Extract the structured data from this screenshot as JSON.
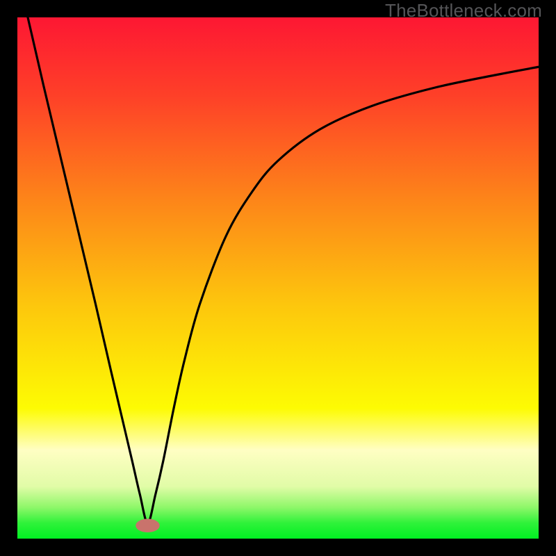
{
  "watermark": "TheBottleneck.com",
  "chart_data": {
    "type": "line",
    "title": "",
    "xlabel": "",
    "ylabel": "",
    "xlim": [
      0,
      100
    ],
    "ylim": [
      0,
      100
    ],
    "grid": false,
    "legend": false,
    "background_gradient": {
      "stops": [
        {
          "offset": 0.0,
          "color": "#fd1733"
        },
        {
          "offset": 0.15,
          "color": "#fe4028"
        },
        {
          "offset": 0.35,
          "color": "#fd8519"
        },
        {
          "offset": 0.55,
          "color": "#fdc60d"
        },
        {
          "offset": 0.75,
          "color": "#fdfb03"
        },
        {
          "offset": 0.83,
          "color": "#fffec3"
        },
        {
          "offset": 0.9,
          "color": "#e1fca7"
        },
        {
          "offset": 0.94,
          "color": "#8ef769"
        },
        {
          "offset": 0.97,
          "color": "#2ff23a"
        },
        {
          "offset": 1.0,
          "color": "#01ef22"
        }
      ]
    },
    "series": [
      {
        "name": "bottleneck-curve",
        "color": "#000000",
        "x": [
          2,
          5,
          10,
          15,
          18,
          20,
          22,
          23.5,
          25,
          26.5,
          28,
          30,
          32,
          35,
          40,
          45,
          50,
          58,
          68,
          80,
          92,
          100
        ],
        "y": [
          100,
          87,
          66,
          45,
          32,
          23.5,
          15,
          8.5,
          3,
          8.5,
          15,
          25,
          34,
          45,
          58,
          66.5,
          72.5,
          78.5,
          83,
          86.5,
          89,
          90.5
        ]
      }
    ],
    "marker": {
      "name": "optimum-marker",
      "x": 25,
      "y": 2.5,
      "rx": 2.3,
      "ry": 1.3,
      "color": "#c9736c"
    }
  }
}
